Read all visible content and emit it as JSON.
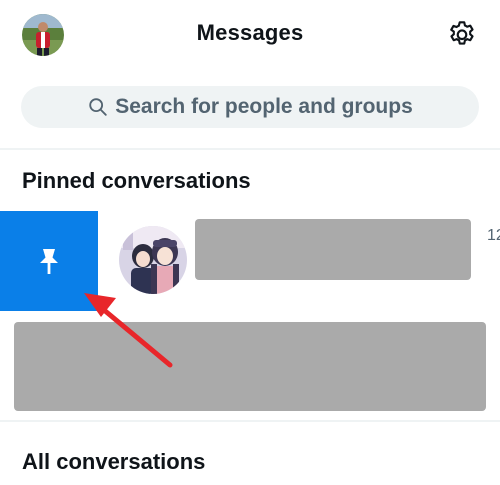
{
  "header": {
    "title": "Messages",
    "avatar_icon": "user-avatar",
    "settings_icon": "gear-icon"
  },
  "search": {
    "placeholder": "Search for people and groups",
    "icon": "search-icon"
  },
  "pinned": {
    "heading": "Pinned conversations",
    "action_icon": "pin-icon",
    "action_color": "#0a7fe8",
    "conversation": {
      "avatar_icon": "anime-avatar",
      "time": "12"
    }
  },
  "all": {
    "heading": "All conversations"
  },
  "annotation": {
    "arrow_color": "#e8262a",
    "arrow_icon": "red-arrow-icon"
  }
}
